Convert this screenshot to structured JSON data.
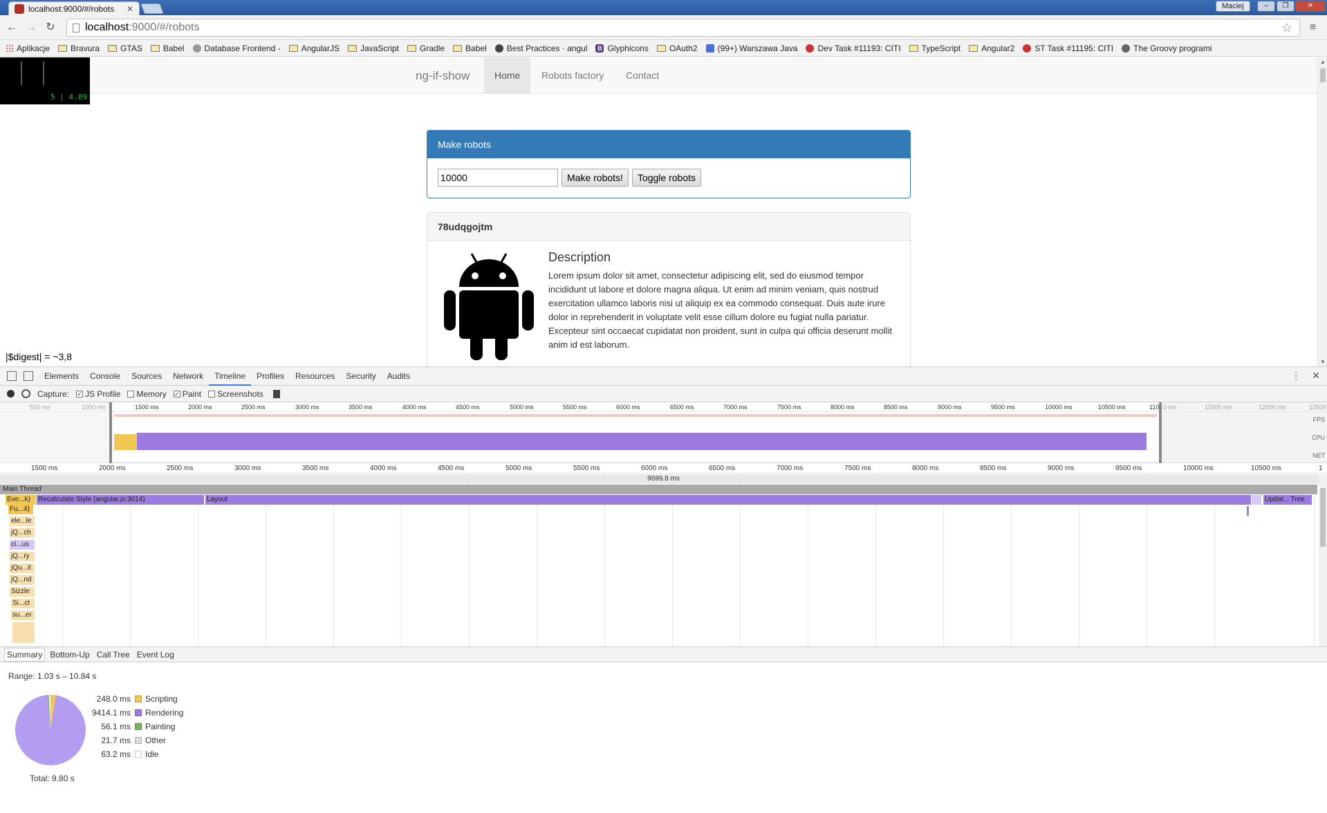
{
  "window": {
    "tab_title": "localhost:9000/#/robots",
    "user": "Maciej",
    "min": "–",
    "max": "❐",
    "close": "✕"
  },
  "toolbar": {
    "url_host": "localhost",
    "url_path": ":9000/#/robots"
  },
  "bookmarks": [
    "Aplikacje",
    "Bravura",
    "GTAS",
    "Babel",
    "Database Frontend - ",
    "AngularJS",
    "JavaScript",
    "Gradle",
    "Babel",
    "Best Practices · angul",
    "Glyphicons",
    "OAuth2",
    "(99+) Warszawa Java",
    "Dev Task #11193: CITI",
    "TypeScript",
    "Angular2",
    "ST Task #11195: CITI",
    "The Groovy programi"
  ],
  "stats": {
    "value": "5 | 4.09"
  },
  "navbar": {
    "brand": "ng-if-show",
    "links": [
      "Home",
      "Robots factory",
      "Contact"
    ]
  },
  "make_panel": {
    "title": "Make robots",
    "count_value": "10000",
    "make_label": "Make robots!",
    "toggle_label": "Toggle robots"
  },
  "robot": {
    "name": "78udqgojtm",
    "desc_title": "Description",
    "desc_text": "Lorem ipsum dolor sit amet, consectetur adipiscing elit, sed do eiusmod tempor incididunt ut labore et dolore magna aliqua. Ut enim ad minim veniam, quis nostrud exercitation ullamco laboris nisi ut aliquip ex ea commodo consequat. Duis aute irure dolor in reprehenderit in voluptate velit esse cillum dolore eu fugiat nulla pariatur. Excepteur sint occaecat cupidatat non proident, sunt in culpa qui officia deserunt mollit anim id est laborum."
  },
  "digest": "|$digest| = ~3,8",
  "devtools": {
    "tabs": [
      "Elements",
      "Console",
      "Sources",
      "Network",
      "Timeline",
      "Profiles",
      "Resources",
      "Security",
      "Audits"
    ],
    "active_tab": "Timeline",
    "capture_label": "Capture:",
    "capture_opts": [
      {
        "label": "JS Profile",
        "checked": true
      },
      {
        "label": "Memory",
        "checked": false
      },
      {
        "label": "Paint",
        "checked": true
      },
      {
        "label": "Screenshots",
        "checked": false
      }
    ],
    "overview_ticks": [
      "500 ms",
      "1000 ms",
      "1500 ms",
      "2000 ms",
      "2500 ms",
      "3000 ms",
      "3500 ms",
      "4000 ms",
      "4500 ms",
      "5000 ms",
      "5500 ms",
      "6000 ms",
      "6500 ms",
      "7000 ms",
      "7500 ms",
      "8000 ms",
      "8500 ms",
      "9000 ms",
      "9500 ms",
      "10000 ms",
      "10500 ms",
      "110",
      "0 ms",
      "11500 ms",
      "12000 ms",
      "12500"
    ],
    "overview_rows": [
      "FPS",
      "CPU",
      "NET"
    ],
    "flame_ticks": [
      "1500 ms",
      "2000 ms",
      "2500 ms",
      "3000 ms",
      "3500 ms",
      "4000 ms",
      "4500 ms",
      "5000 ms",
      "5500 ms",
      "6000 ms",
      "6500 ms",
      "7000 ms",
      "7500 ms",
      "8000 ms",
      "8500 ms",
      "9000 ms",
      "9500 ms",
      "10000 ms",
      "10500 ms",
      "1"
    ],
    "range_duration": "9699.8 ms",
    "main_thread": "Main Thread",
    "events": {
      "evt": "Eve...k)",
      "recalc": "Recalculate Style (angular.js:3014)",
      "layout": "Layout",
      "update": "Updat... Tree",
      "stack": [
        "Fu...4)",
        "ele...le",
        "jQ...ch",
        "cl...us",
        "jQ...ry",
        "jQu...it",
        "jQ...nd",
        "Sizzle",
        "Si...ct",
        "su...er"
      ]
    },
    "summary_tabs": [
      "Summary",
      "Bottom-Up",
      "Call Tree",
      "Event Log"
    ],
    "range": "Range: 1.03 s – 10.84 s",
    "breakdown": [
      {
        "time": "248.0 ms",
        "label": "Scripting",
        "color": "#f2c653",
        "ms": 248.0
      },
      {
        "time": "9414.1 ms",
        "label": "Rendering",
        "color": "#9b7be0",
        "ms": 9414.1
      },
      {
        "time": "56.1 ms",
        "label": "Painting",
        "color": "#71b363",
        "ms": 56.1
      },
      {
        "time": "21.7 ms",
        "label": "Other",
        "color": "#dadada",
        "ms": 21.7
      },
      {
        "time": "63.2 ms",
        "label": "Idle",
        "color": "#ffffff",
        "ms": 63.2
      }
    ],
    "total": "Total: 9.80 s"
  }
}
